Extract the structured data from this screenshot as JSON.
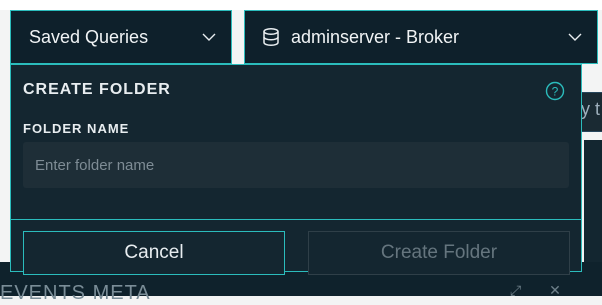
{
  "header": {
    "saved_queries_label": "Saved Queries",
    "server_label": "adminserver - Broker"
  },
  "dialog": {
    "title": "CREATE FOLDER",
    "folder_name_label": "FOLDER NAME",
    "folder_name_placeholder": "Enter folder name",
    "folder_name_value": "",
    "cancel_label": "Cancel",
    "create_label": "Create Folder"
  },
  "background": {
    "input_fragment": "y t",
    "section_title": "EVENTS META"
  },
  "colors": {
    "accent": "#2bbcbc",
    "panel": "#142630",
    "dark": "#0e202b",
    "text": "#e8edf0",
    "disabled_text": "#65757e"
  }
}
